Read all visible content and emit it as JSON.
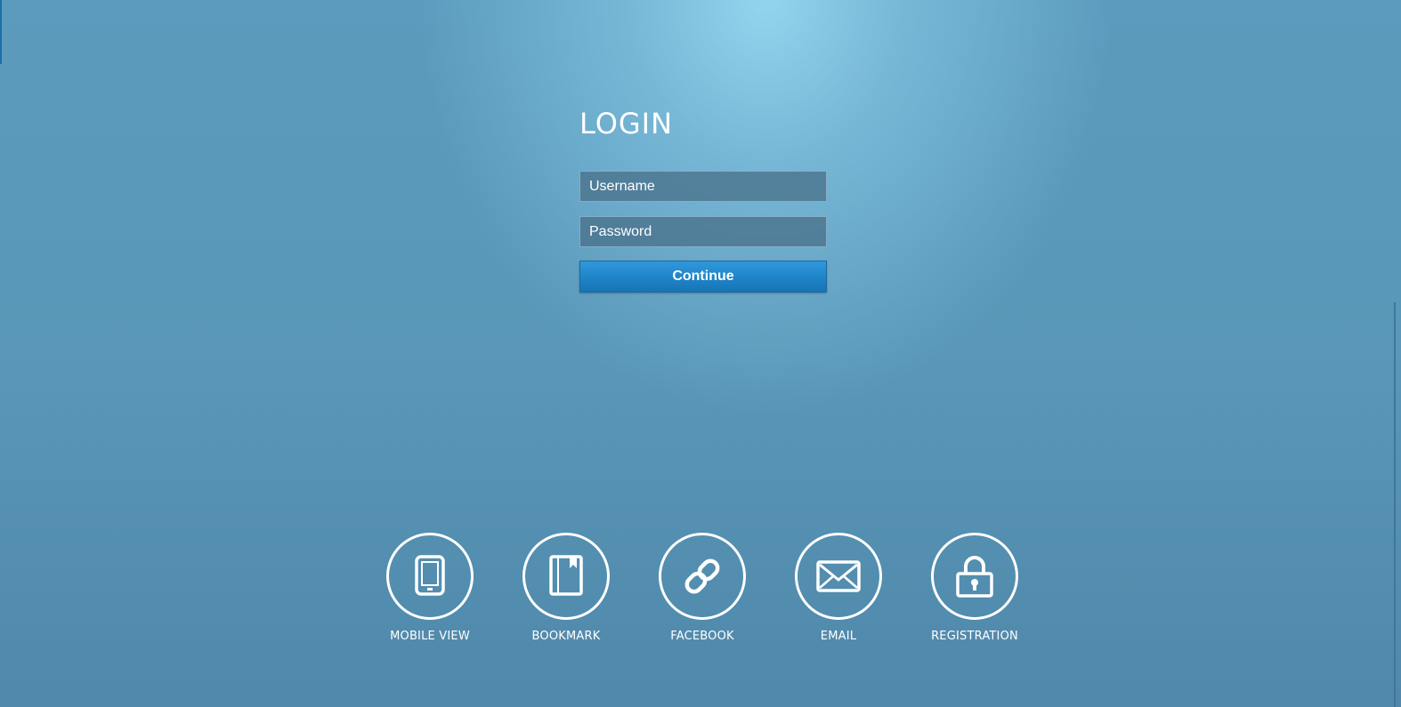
{
  "login": {
    "title": "LOGIN",
    "username_placeholder": "Username",
    "password_placeholder": "Password",
    "continue_label": "Continue"
  },
  "links": [
    {
      "label": "MOBILE VIEW",
      "icon": "tablet-icon"
    },
    {
      "label": "BOOKMARK",
      "icon": "bookmark-icon"
    },
    {
      "label": "FACEBOOK",
      "icon": "link-icon"
    },
    {
      "label": "EMAIL",
      "icon": "envelope-icon"
    },
    {
      "label": "REGISTRATION",
      "icon": "lock-icon"
    }
  ],
  "colors": {
    "button": "#1f86ca",
    "field_background": "#466e87",
    "background": "#5a97b8",
    "text": "#ffffff"
  }
}
